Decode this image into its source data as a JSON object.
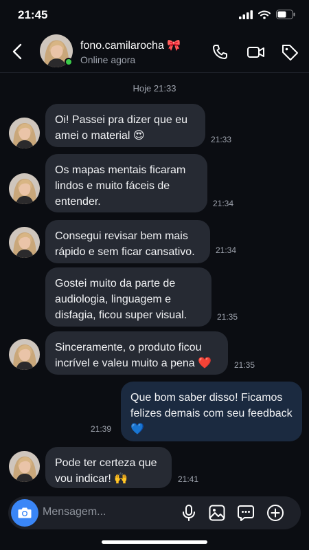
{
  "status_bar": {
    "time": "21:45"
  },
  "header": {
    "name": "fono.camilarocha 🎀",
    "status": "Online agora"
  },
  "chat": {
    "date_separator": "Hoje 21:33",
    "messages": [
      {
        "direction": "in",
        "text": "Oi! Passei pra dizer que eu amei o material 😍",
        "time": "21:33"
      },
      {
        "direction": "in",
        "text": "Os mapas mentais ficaram lindos e muito fáceis de entender.",
        "time": "21:34"
      },
      {
        "direction": "in",
        "text": "Consegui revisar bem mais rápido e sem ficar cansativo.",
        "time": "21:34"
      },
      {
        "direction": "in",
        "text": "Gostei muito da parte de audiologia, linguagem e disfagia, ficou super visual.",
        "time": "21:35"
      },
      {
        "direction": "in",
        "text": "Sinceramente, o produto ficou incrível e valeu muito a pena ❤️",
        "time": "21:35"
      },
      {
        "direction": "out",
        "text": "Que bom saber disso! Ficamos felizes demais com seu feedback 💙",
        "time": "21:39"
      },
      {
        "direction": "in",
        "text": "Pode ter certeza que vou indicar! 🙌",
        "time": "21:41"
      }
    ]
  },
  "composer": {
    "placeholder": "Mensagem..."
  },
  "colors": {
    "background": "#0b0d12",
    "incoming_bubble": "#262a33",
    "outgoing_bubble": "#1b2a40",
    "accent": "#3a86f7",
    "online": "#3ccb4a"
  }
}
